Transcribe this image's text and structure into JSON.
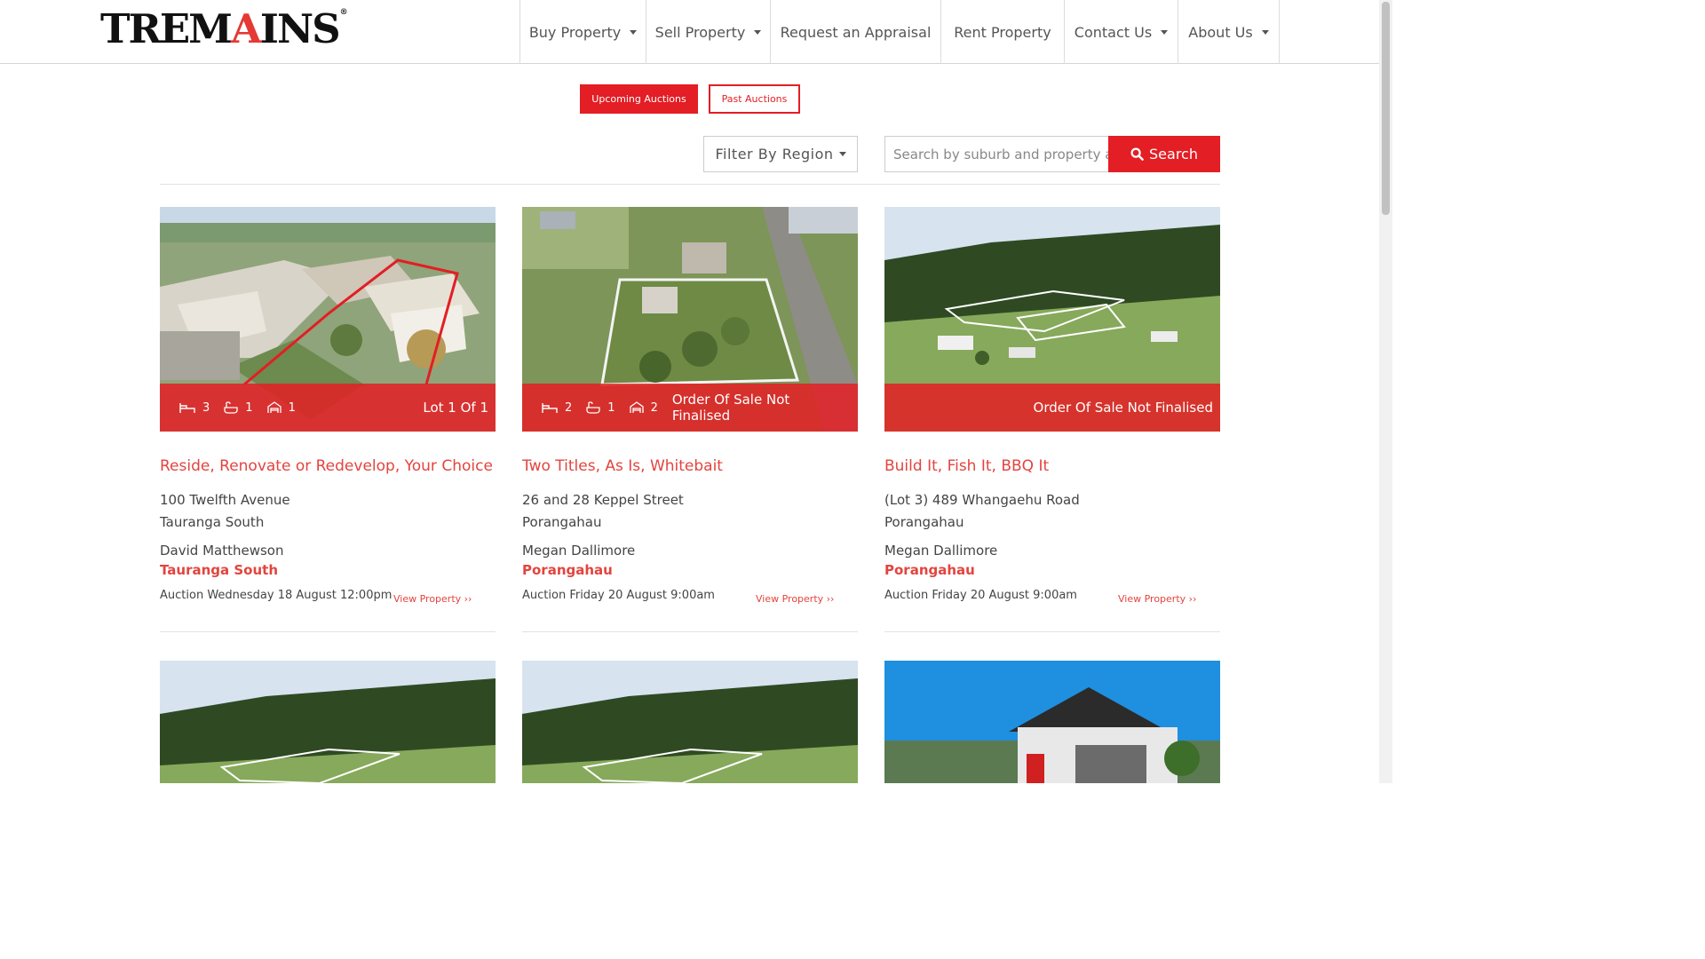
{
  "brand": {
    "logo_pre": "TREM",
    "logo_a": "A",
    "logo_post": "INS",
    "logo_mark": "®",
    "accent": "#e31e24"
  },
  "nav": {
    "items": [
      {
        "label": "Buy Property",
        "dropdown": true
      },
      {
        "label": "Sell Property",
        "dropdown": true
      },
      {
        "label": "Request an Appraisal",
        "dropdown": false
      },
      {
        "label": "Rent Property",
        "dropdown": false
      },
      {
        "label": "Contact Us",
        "dropdown": true
      },
      {
        "label": "About Us",
        "dropdown": true
      }
    ]
  },
  "auctions": {
    "upcoming_label": "Upcoming Auctions",
    "past_label": "Past Auctions"
  },
  "filter": {
    "label": "Filter By Region"
  },
  "search": {
    "placeholder": "Search by suburb and property address",
    "button_label": "Search"
  },
  "cards": [
    {
      "beds": "3",
      "baths": "1",
      "garages": "1",
      "status": "Lot 1 Of 1",
      "title": "Reside, Renovate or Redevelop, Your Choice",
      "address_line1": "100 Twelfth Avenue",
      "address_line2": "Tauranga South",
      "agent": "David Matthewson",
      "suburb": "Tauranga South",
      "auction": "Auction Wednesday 18 August 12:00pm",
      "view_label": "View Property ››"
    },
    {
      "beds": "2",
      "baths": "1",
      "garages": "2",
      "status": "Order Of Sale Not Finalised",
      "title": "Two Titles, As Is, Whitebait",
      "address_line1": "26 and 28 Keppel Street",
      "address_line2": "Porangahau",
      "agent": "Megan Dallimore",
      "suburb": "Porangahau",
      "auction": "Auction Friday 20 August 9:00am",
      "view_label": "View Property ››"
    },
    {
      "status": "Order Of Sale Not Finalised",
      "title": "Build It, Fish It, BBQ It",
      "address_line1": "(Lot 3) 489 Whangaehu Road",
      "address_line2": "Porangahau",
      "agent": "Megan Dallimore",
      "suburb": "Porangahau",
      "auction": "Auction Friday 20 August 9:00am",
      "view_label": "View Property ››"
    }
  ]
}
